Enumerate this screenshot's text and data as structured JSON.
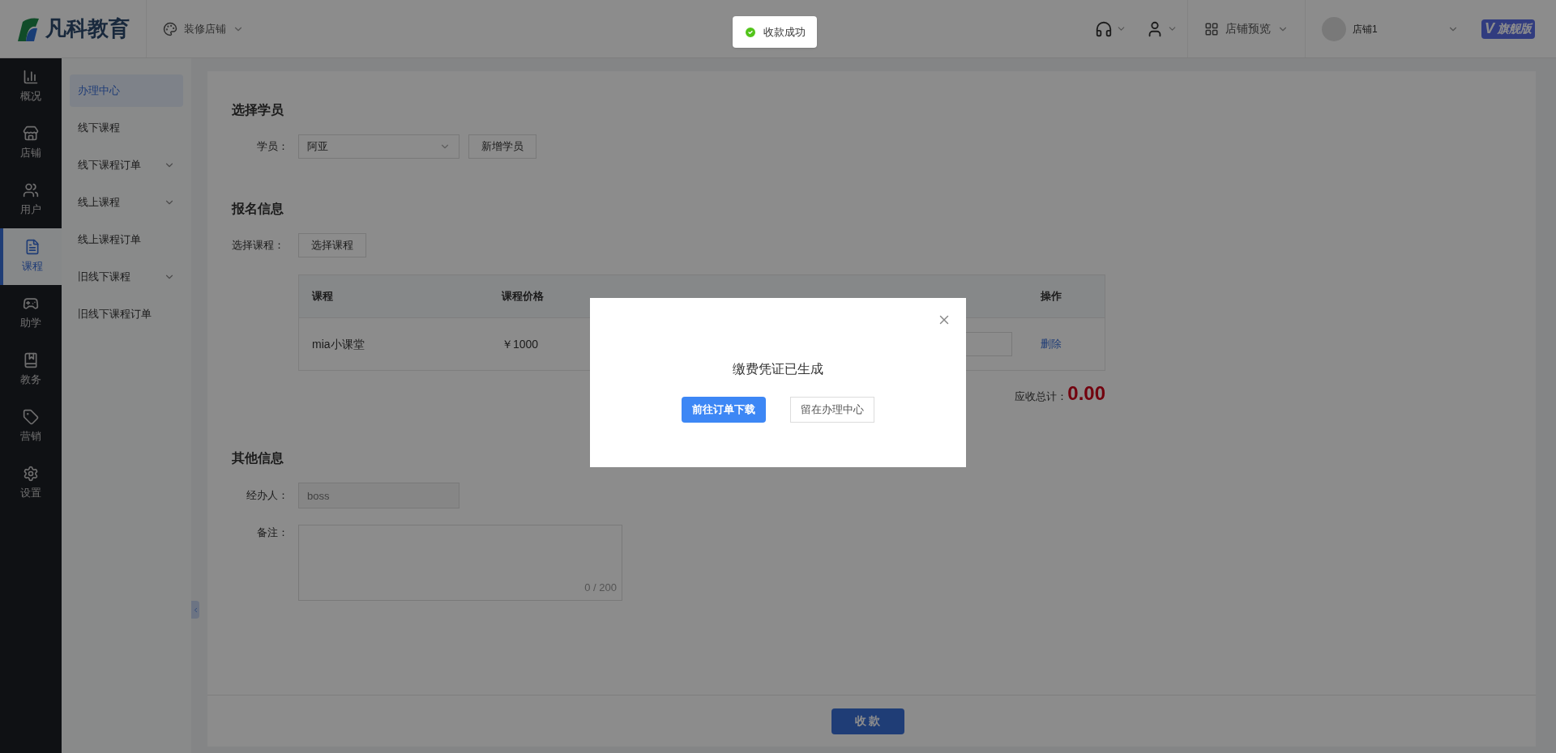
{
  "header": {
    "logo": "凡科教育",
    "decorate": "装修店铺",
    "preview": "店铺预览",
    "shop": "店铺1",
    "edition": "旗舰版",
    "edition_mark": "V"
  },
  "toast": {
    "text": "收款成功"
  },
  "rail": [
    {
      "label": "概况",
      "selected": false
    },
    {
      "label": "店铺",
      "selected": false
    },
    {
      "label": "用户",
      "selected": false
    },
    {
      "label": "课程",
      "selected": true
    },
    {
      "label": "助学",
      "selected": false
    },
    {
      "label": "教务",
      "selected": false
    },
    {
      "label": "营销",
      "selected": false
    },
    {
      "label": "设置",
      "selected": false
    }
  ],
  "submenu": [
    {
      "label": "办理中心",
      "kind": "link",
      "selected": true
    },
    {
      "label": "线下课程",
      "kind": "link",
      "selected": false
    },
    {
      "label": "线下课程订单",
      "kind": "group",
      "selected": false
    },
    {
      "label": "线上课程",
      "kind": "group",
      "selected": false
    },
    {
      "label": "线上课程订单",
      "kind": "link",
      "selected": false
    },
    {
      "label": "旧线下课程",
      "kind": "group",
      "selected": false
    },
    {
      "label": "旧线下课程订单",
      "kind": "link",
      "selected": false
    }
  ],
  "student": {
    "title": "选择学员",
    "label": "学员：",
    "value": "阿亚",
    "add_button": "新增学员"
  },
  "signup": {
    "title": "报名信息",
    "label": "选择课程：",
    "button": "选择课程",
    "table": {
      "columns": [
        "课程",
        "课程价格",
        "操作"
      ],
      "rows": [
        {
          "course": "mia小课堂",
          "price": "￥1000",
          "action": "删除"
        }
      ]
    },
    "total_label": "应收总计：",
    "total": "0.00"
  },
  "other": {
    "title": "其他信息",
    "handler_label": "经办人：",
    "handler": "boss",
    "handler_disabled": true,
    "note_label": "备注：",
    "counter": "0 / 200"
  },
  "footer": {
    "button": "收 款"
  },
  "dialog": {
    "message": "缴费凭证已生成",
    "primary": "前往订单下载",
    "secondary": "留在办理中心"
  }
}
